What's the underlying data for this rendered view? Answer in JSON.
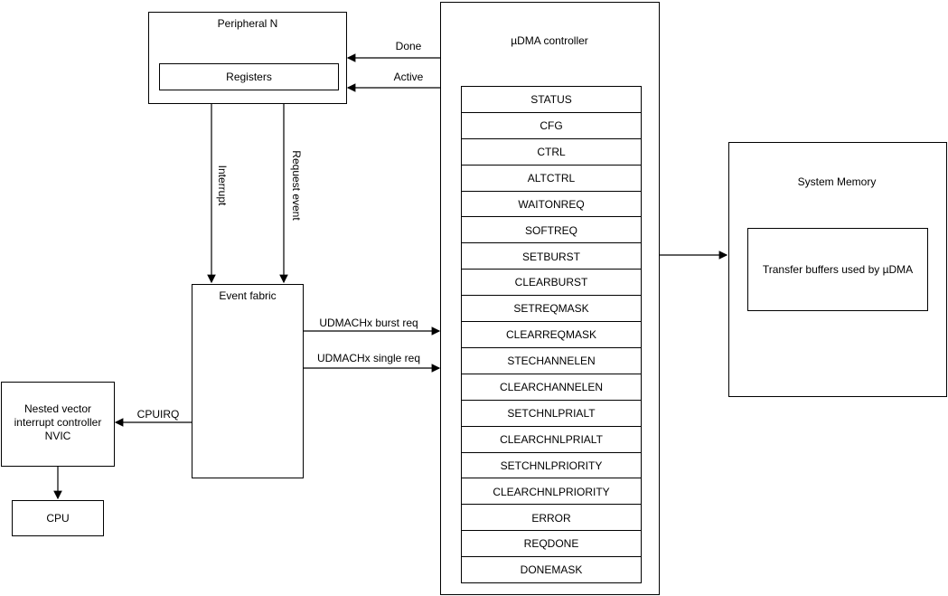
{
  "peripheral": {
    "title": "Peripheral N",
    "registers": "Registers"
  },
  "udma": {
    "title": "µDMA controller",
    "registers": [
      "STATUS",
      "CFG",
      "CTRL",
      "ALTCTRL",
      "WAITONREQ",
      "SOFTREQ",
      "SETBURST",
      "CLEARBURST",
      "SETREQMASK",
      "CLEARREQMASK",
      "STECHANNELEN",
      "CLEARCHANNELEN",
      "SETCHNLPRIALT",
      "CLEARCHNLPRIALT",
      "SETCHNLPRIORITY",
      "CLEARCHNLPRIORITY",
      "ERROR",
      "REQDONE",
      "DONEMASK"
    ]
  },
  "signals": {
    "done": "Done",
    "active": "Active",
    "interrupt": "Interrupt",
    "request_event": "Request event",
    "burst_req": "UDMACHx burst req",
    "single_req": "UDMACHx single req",
    "cpuirq": "CPUIRQ"
  },
  "event_fabric": {
    "title": "Event fabric"
  },
  "nvic": {
    "line1": "Nested vector",
    "line2": "interrupt controller",
    "line3": "NVIC"
  },
  "cpu": {
    "title": "CPU"
  },
  "memory": {
    "title": "System Memory",
    "buffers": "Transfer buffers used by µDMA"
  }
}
